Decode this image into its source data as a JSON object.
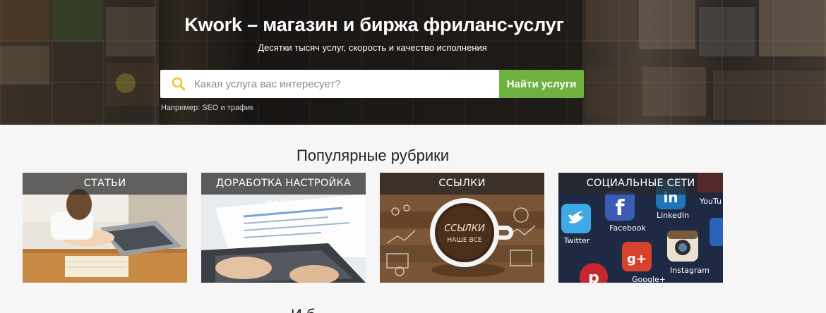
{
  "hero": {
    "title": "Kwork – магазин и биржа фриланс-услуг",
    "subtitle": "Десятки тысяч услуг, скорость и качество исполнения",
    "search": {
      "placeholder": "Какая услуга вас интересует?",
      "button_label": "Найти услуги",
      "icon": "search-icon"
    },
    "example": {
      "prefix": "Например:",
      "link": "SEO и трафик"
    }
  },
  "popular": {
    "title": "Популярные рубрики",
    "categories": [
      {
        "label": "СТАТЬИ"
      },
      {
        "label": "ДОРАБОТКА НАСТРОЙКА САЙТА"
      },
      {
        "label": "ССЫЛКИ",
        "badge_line1": "ССЫЛКИ",
        "badge_line2": "НАШЕ ВСЕ"
      },
      {
        "label": "СОЦИАЛЬНЫЕ СЕТИ",
        "apps": [
          "Twitter",
          "Facebook",
          "LinkedIn",
          "YouTu",
          "Instagram",
          "Google+"
        ]
      }
    ]
  },
  "next_section": {
    "title_partial": "И   б"
  },
  "colors": {
    "accent_green": "#6fb13f",
    "search_icon": "#f2c230",
    "bar_overlay": "#282828"
  }
}
